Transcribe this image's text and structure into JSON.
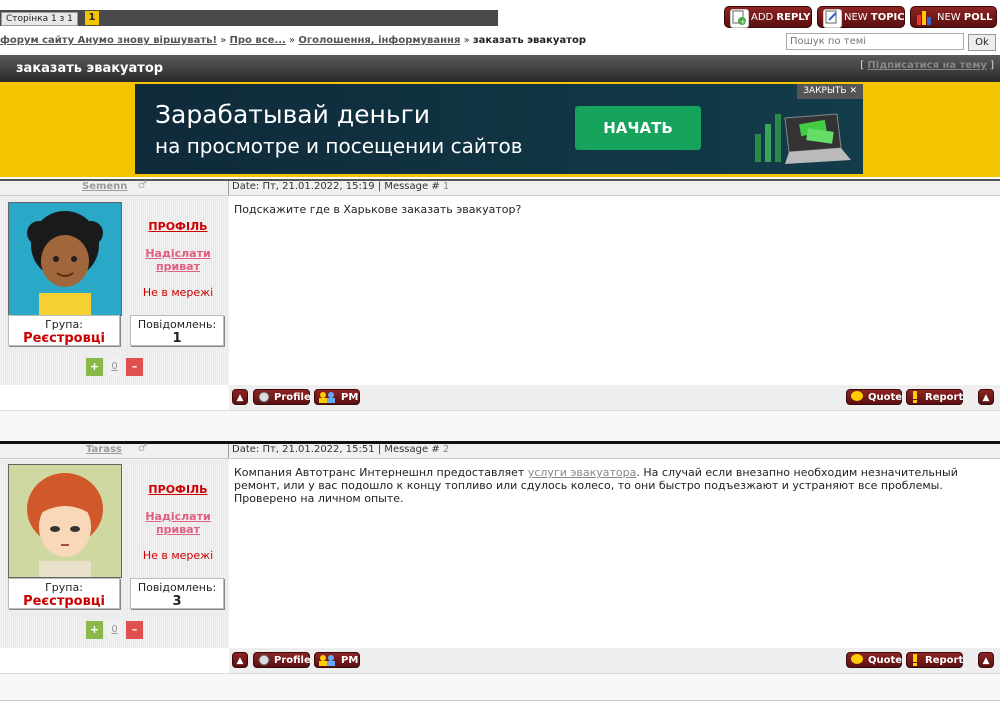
{
  "pager": {
    "label": "Сторінка 1 з 1",
    "current": "1"
  },
  "top_buttons": {
    "add_reply": {
      "prefix": "ADD ",
      "bold": "REPLY"
    },
    "new_topic": {
      "prefix": "NEW ",
      "bold": "TOPIC"
    },
    "new_poll": {
      "prefix": "NEW ",
      "bold": "POLL"
    }
  },
  "breadcrumb": {
    "items": [
      "форум сайту Анумо знову віршувать!",
      "Про все...",
      "Оголошення, інформування"
    ],
    "separator": "»",
    "current": "заказать эвакуатор"
  },
  "search": {
    "placeholder": "Пошук по темі",
    "button": "Ok"
  },
  "topic": {
    "title": "заказать эвакуатор",
    "subscribe": "Підписатися на тему"
  },
  "ad": {
    "line1": "Зарабатывай деньги",
    "line2": "на просмотре и посещении сайтов",
    "button": "НАЧАТЬ",
    "close": "ЗАКРЫТЬ"
  },
  "labels": {
    "profile": "ПРОФІЛЬ",
    "send_private": "Надіслати приват",
    "offline": "Не в мережі",
    "group": "Група:",
    "messages": "Повідомлень:",
    "plus": "+",
    "minus": "–",
    "profile_btn": "Profile",
    "pm_btn": "PM",
    "quote_btn": "Quote",
    "report_btn": "Report"
  },
  "posts": [
    {
      "username": "Semenn",
      "date_prefix": "Date: Пт, 21.01.2022, 15:19 | Message #",
      "msg_num": "1",
      "group": "Реєстровці",
      "msg_count": "1",
      "rating": "0",
      "text": "Подскажите где в Харькове заказать эвакуатор?"
    },
    {
      "username": "Tarass",
      "date_prefix": "Date: Пт, 21.01.2022, 15:51 | Message #",
      "msg_num": "2",
      "group": "Реєстровці",
      "msg_count": "3",
      "rating": "0",
      "text_before": "Компания Автотранс Интернешнл предоставляет ",
      "text_link": "услуги эвакуатора",
      "text_after": ". На случай если внезапно необходим незначительный ремонт, или у вас подошло к концу топливо или сдулось колесо, то они быстро подъезжают и устраняют все проблемы. Проверено на личном опыте."
    }
  ],
  "colors": {
    "accent_red": "#8e2424",
    "ad_yellow": "#f5c400",
    "ad_green": "#16a35b"
  }
}
